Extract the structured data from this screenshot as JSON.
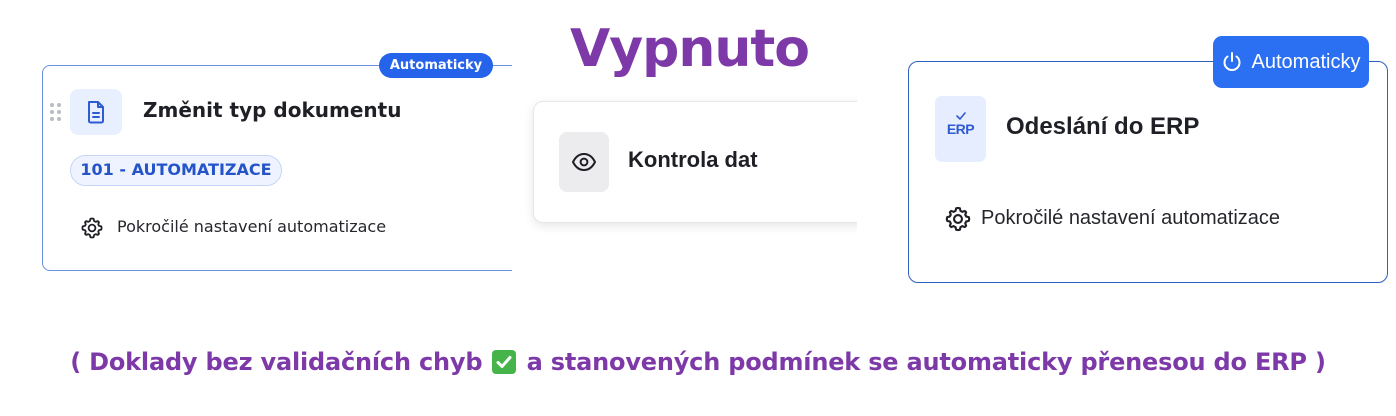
{
  "header": {
    "state_title": "Vypnuto"
  },
  "card_change_type": {
    "badge": "Automaticky",
    "icon": "document-icon",
    "title": "Změnit typ dokumentu",
    "code_pill": "101 - AUTOMATIZACE",
    "advanced_label": "Pokročilé nastavení automatizace",
    "advanced_icon": "gear-icon"
  },
  "card_data_check": {
    "icon": "eye-icon",
    "title": "Kontrola dat"
  },
  "card_erp": {
    "badge": "Automaticky",
    "badge_icon": "power-icon",
    "icon_text": "ERP",
    "title": "Odeslání do ERP",
    "advanced_label": "Pokročilé nastavení automatizace",
    "advanced_icon": "gear-icon"
  },
  "footnote": {
    "before": "( Doklady bez validačních chyb",
    "after": "a stanovených podmínek se automaticky přenesou do ERP )",
    "emoji": "check-mark-icon"
  },
  "colors": {
    "brand_purple": "#7d39a8",
    "accent_blue": "#2563eb",
    "badge_blue": "#2b6ff2"
  }
}
